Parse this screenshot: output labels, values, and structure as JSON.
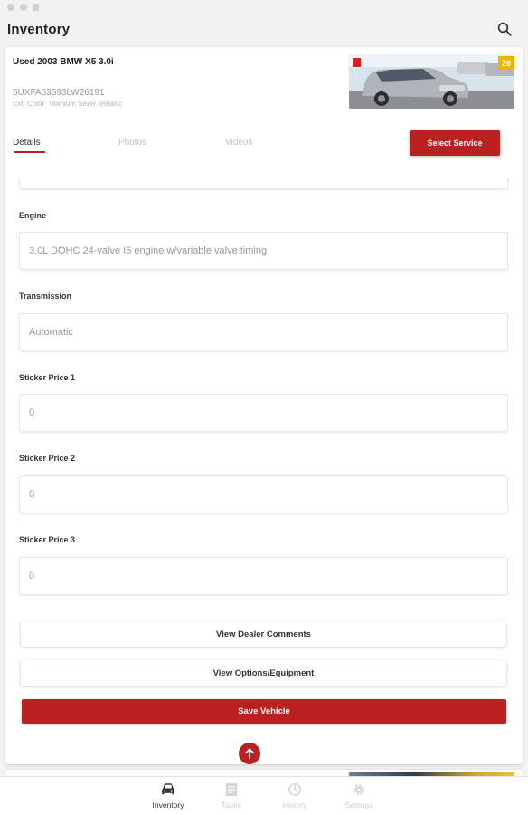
{
  "app": {
    "title": "Inventory"
  },
  "vehicle": {
    "title": "Used 2003 BMW X5 3.0i",
    "vin": "5UXFA53593LW26191",
    "ext_color": "Ext. Color: Titanium Silver Metallic",
    "photo_count": "26"
  },
  "tabs": [
    {
      "label": "Details",
      "active": true
    },
    {
      "label": "Photos",
      "active": false
    },
    {
      "label": "Videos",
      "active": false
    }
  ],
  "select_service_label": "Select Service",
  "fields": [
    {
      "label": "Engine",
      "value": "3.0L DOHC 24-valve I6 engine w/variable valve timing"
    },
    {
      "label": "Transmission",
      "value": "Automatic"
    },
    {
      "label": "Sticker Price 1",
      "value": "0"
    },
    {
      "label": "Sticker Price 2",
      "value": "0"
    },
    {
      "label": "Sticker Price 3",
      "value": "0"
    }
  ],
  "buttons": {
    "view_dealer_comments": "View Dealer Comments",
    "view_options": "View Options/Equipment",
    "save_vehicle": "Save Vehicle"
  },
  "bottom_nav": [
    {
      "label": "Inventory",
      "icon": "car-icon",
      "active": true
    },
    {
      "label": "Tasks",
      "icon": "tasks-icon",
      "active": false
    },
    {
      "label": "History",
      "icon": "history-icon",
      "active": false
    },
    {
      "label": "Settings",
      "icon": "gear-icon",
      "active": false
    }
  ],
  "colors": {
    "accent": "#b8211f",
    "badge": "#f0b400"
  }
}
